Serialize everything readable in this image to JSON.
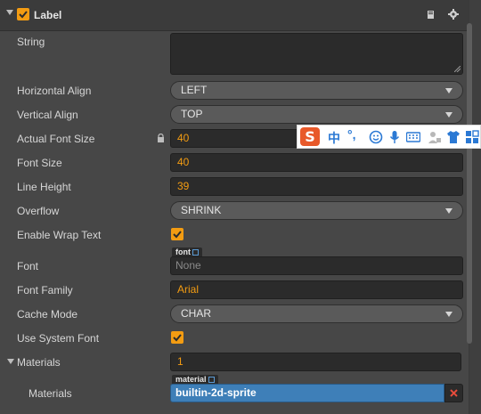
{
  "header": {
    "title": "Label",
    "enabled": true,
    "book_icon": "book-icon",
    "gear_icon": "gear-icon"
  },
  "props": {
    "string": {
      "label": "String",
      "value": ""
    },
    "horizontal_align": {
      "label": "Horizontal Align",
      "value": "LEFT"
    },
    "vertical_align": {
      "label": "Vertical Align",
      "value": "TOP"
    },
    "actual_font_size": {
      "label": "Actual Font Size",
      "value": "40"
    },
    "font_size": {
      "label": "Font Size",
      "value": "40"
    },
    "line_height": {
      "label": "Line Height",
      "value": "39"
    },
    "overflow": {
      "label": "Overflow",
      "value": "SHRINK"
    },
    "enable_wrap_text": {
      "label": "Enable Wrap Text",
      "checked": true
    },
    "font": {
      "label": "Font",
      "tag": "font",
      "value": "None"
    },
    "font_family": {
      "label": "Font Family",
      "value": "Arial"
    },
    "cache_mode": {
      "label": "Cache Mode",
      "value": "CHAR"
    },
    "use_system_font": {
      "label": "Use System Font",
      "checked": true
    },
    "materials": {
      "label": "Materials",
      "count": "1"
    },
    "materials_item": {
      "label": "Materials",
      "tag": "material",
      "value": "builtin-2d-sprite"
    }
  },
  "ime_toolbar": {
    "logo": "S",
    "mode": "中",
    "punct": "°,",
    "icons": [
      "smiley-icon",
      "microphone-icon",
      "keyboard-icon",
      "user-icon",
      "shirt-icon",
      "grid-icon"
    ]
  },
  "colors": {
    "accent": "#f39c12",
    "selection": "#3e7fb8",
    "delete": "#e74c3c"
  }
}
